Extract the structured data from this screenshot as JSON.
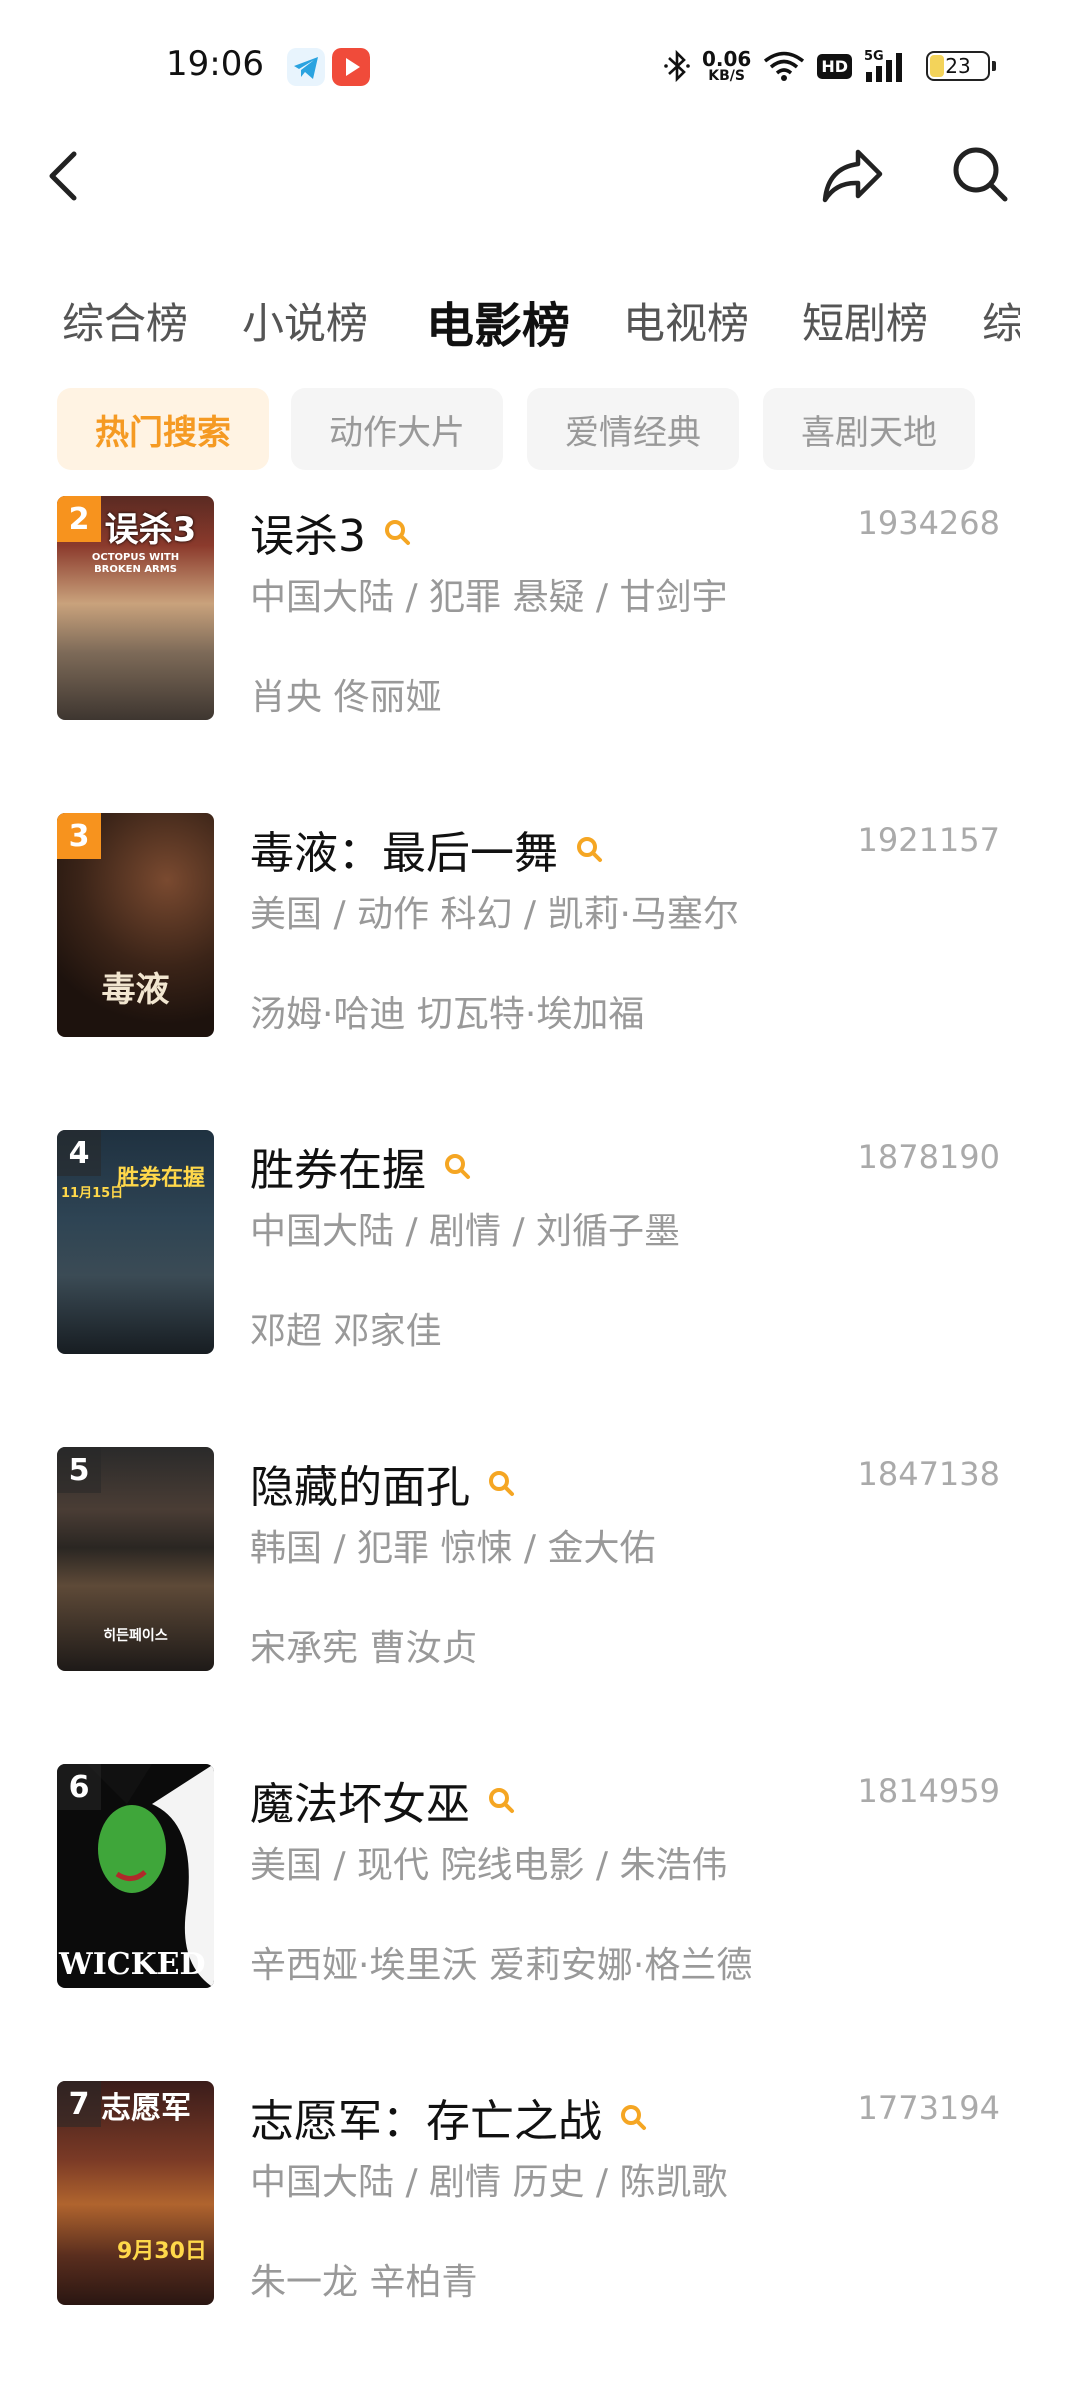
{
  "status_bar": {
    "time": "19:06",
    "net_speed": "0.06",
    "net_unit": "KB/S",
    "hd": "HD",
    "signal_type": "5G",
    "battery": "23",
    "battery_level": 0.23,
    "icons": [
      "telegram-icon",
      "video-app-icon",
      "bluetooth-icon",
      "wifi-icon",
      "signal-icon",
      "battery-icon"
    ]
  },
  "nav": {
    "icons": [
      "back-icon",
      "share-icon",
      "search-icon"
    ]
  },
  "category_tabs": [
    {
      "label": "综合榜"
    },
    {
      "label": "小说榜"
    },
    {
      "label": "电影榜",
      "active": true
    },
    {
      "label": "电视榜"
    },
    {
      "label": "短剧榜"
    },
    {
      "label": "综"
    }
  ],
  "sub_tabs": [
    {
      "label": "热门搜索",
      "active": true
    },
    {
      "label": "动作大片"
    },
    {
      "label": "爱情经典"
    },
    {
      "label": "喜剧天地"
    }
  ],
  "colors": {
    "accent": "#f59a23",
    "rank_orange": "#f7931e",
    "text_gray": "#999999"
  },
  "movies": [
    {
      "rank": "2",
      "title": "误杀3",
      "heat": "1934268",
      "meta": "中国大陆 / 犯罪 悬疑 / 甘剑宇",
      "cast": "肖央 佟丽娅",
      "poster_title": "误杀3",
      "poster_subtitle": "OCTOPUS WITH BROKEN ARMS"
    },
    {
      "rank": "3",
      "title": "毒液：最后一舞",
      "heat": "1921157",
      "meta": "美国 / 动作 科幻 / 凯莉·马塞尔",
      "cast": "汤姆·哈迪   切瓦特·埃加福",
      "poster_title": "毒液"
    },
    {
      "rank": "4",
      "title": "胜券在握",
      "heat": "1878190",
      "meta": "中国大陆 / 剧情 / 刘循子墨",
      "cast": "邓超 邓家佳",
      "poster_title": "胜券在握",
      "poster_date": "11月15日"
    },
    {
      "rank": "5",
      "title": "隐藏的面孔",
      "heat": "1847138",
      "meta": "韩国 / 犯罪 惊悚 / 金大佑",
      "cast": "宋承宪 曹汝贞",
      "poster_title": "히든페이스"
    },
    {
      "rank": "6",
      "title": "魔法坏女巫",
      "heat": "1814959",
      "meta": "美国 / 现代 院线电影 / 朱浩伟",
      "cast": "辛西娅·埃里沃 爱莉安娜·格兰德",
      "poster_title": "WICKED"
    },
    {
      "rank": "7",
      "title": "志愿军：存亡之战",
      "heat": "1773194",
      "meta": "中国大陆 / 剧情 历史 / 陈凯歌",
      "cast": "朱一龙 辛柏青",
      "poster_title": "志愿军",
      "poster_date": "9月30日"
    }
  ]
}
